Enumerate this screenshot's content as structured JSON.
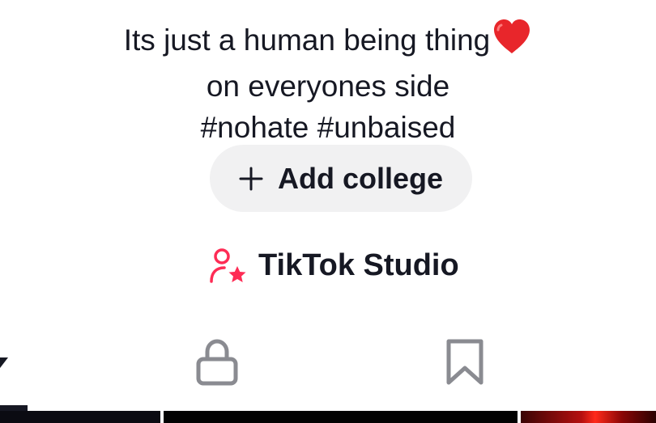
{
  "bio": {
    "line1": "Its just a human being thing",
    "line1_emoji": "red-heart",
    "line2": "on everyones side",
    "line3": "#nohate #unbaised"
  },
  "add_college": {
    "icon": "plus-icon",
    "label": "Add college"
  },
  "studio": {
    "icon": "person-star-icon",
    "label": "TikTok Studio",
    "accent_color": "#fe2c55"
  },
  "tabs": [
    {
      "icon": "dropdown-arrow-icon",
      "state": "active"
    },
    {
      "icon": "lock-icon",
      "state": "inactive"
    },
    {
      "icon": "bookmark-icon",
      "state": "inactive"
    }
  ],
  "colors": {
    "text": "#161823",
    "pill_bg": "#f1f1f2",
    "inactive_icon": "#8a8b91"
  }
}
